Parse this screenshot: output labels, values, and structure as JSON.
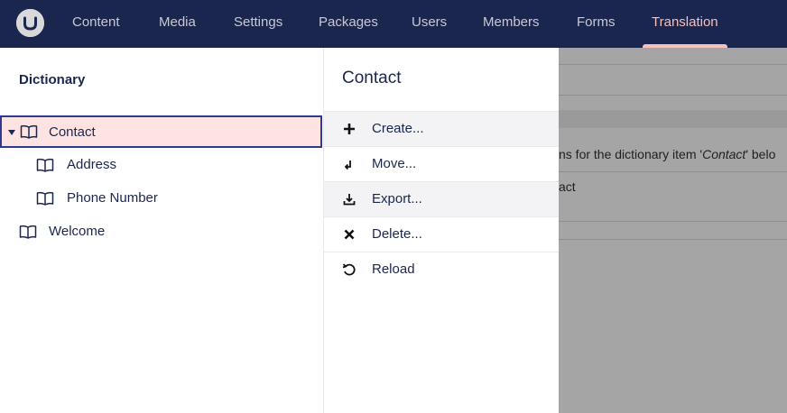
{
  "topbar": {
    "logo_icon": "umbraco-logo-icon",
    "nav": [
      {
        "label": "Content",
        "active": false
      },
      {
        "label": "Media",
        "active": false
      },
      {
        "label": "Settings",
        "active": false
      },
      {
        "label": "Packages",
        "active": false
      },
      {
        "label": "Users",
        "active": false
      },
      {
        "label": "Members",
        "active": false
      },
      {
        "label": "Forms",
        "active": false
      },
      {
        "label": "Translation",
        "active": true
      }
    ]
  },
  "tree": {
    "title": "Dictionary",
    "items": [
      {
        "label": "Contact",
        "icon": "book-icon",
        "selected": true,
        "expanded": true
      },
      {
        "label": "Address",
        "icon": "book-icon"
      },
      {
        "label": "Phone Number",
        "icon": "book-icon"
      },
      {
        "label": "Welcome",
        "icon": "book-icon"
      }
    ]
  },
  "menu": {
    "title": "Contact",
    "items": [
      {
        "label": "Create...",
        "icon": "plus-icon"
      },
      {
        "label": "Move...",
        "icon": "move-icon"
      },
      {
        "label": "Export...",
        "icon": "export-icon"
      },
      {
        "label": "Delete...",
        "icon": "delete-icon"
      },
      {
        "label": "Reload",
        "icon": "reload-icon"
      }
    ]
  },
  "background": {
    "text_pre": "ns for the dictionary item '",
    "text_item": "Contact",
    "text_post": "' belo",
    "value_fragment": "act"
  },
  "colors": {
    "topbar": "#1b264f",
    "active_nav": "#f5c1bc",
    "selected_row": "#fde3e1",
    "selected_border": "#2e3a8f"
  }
}
